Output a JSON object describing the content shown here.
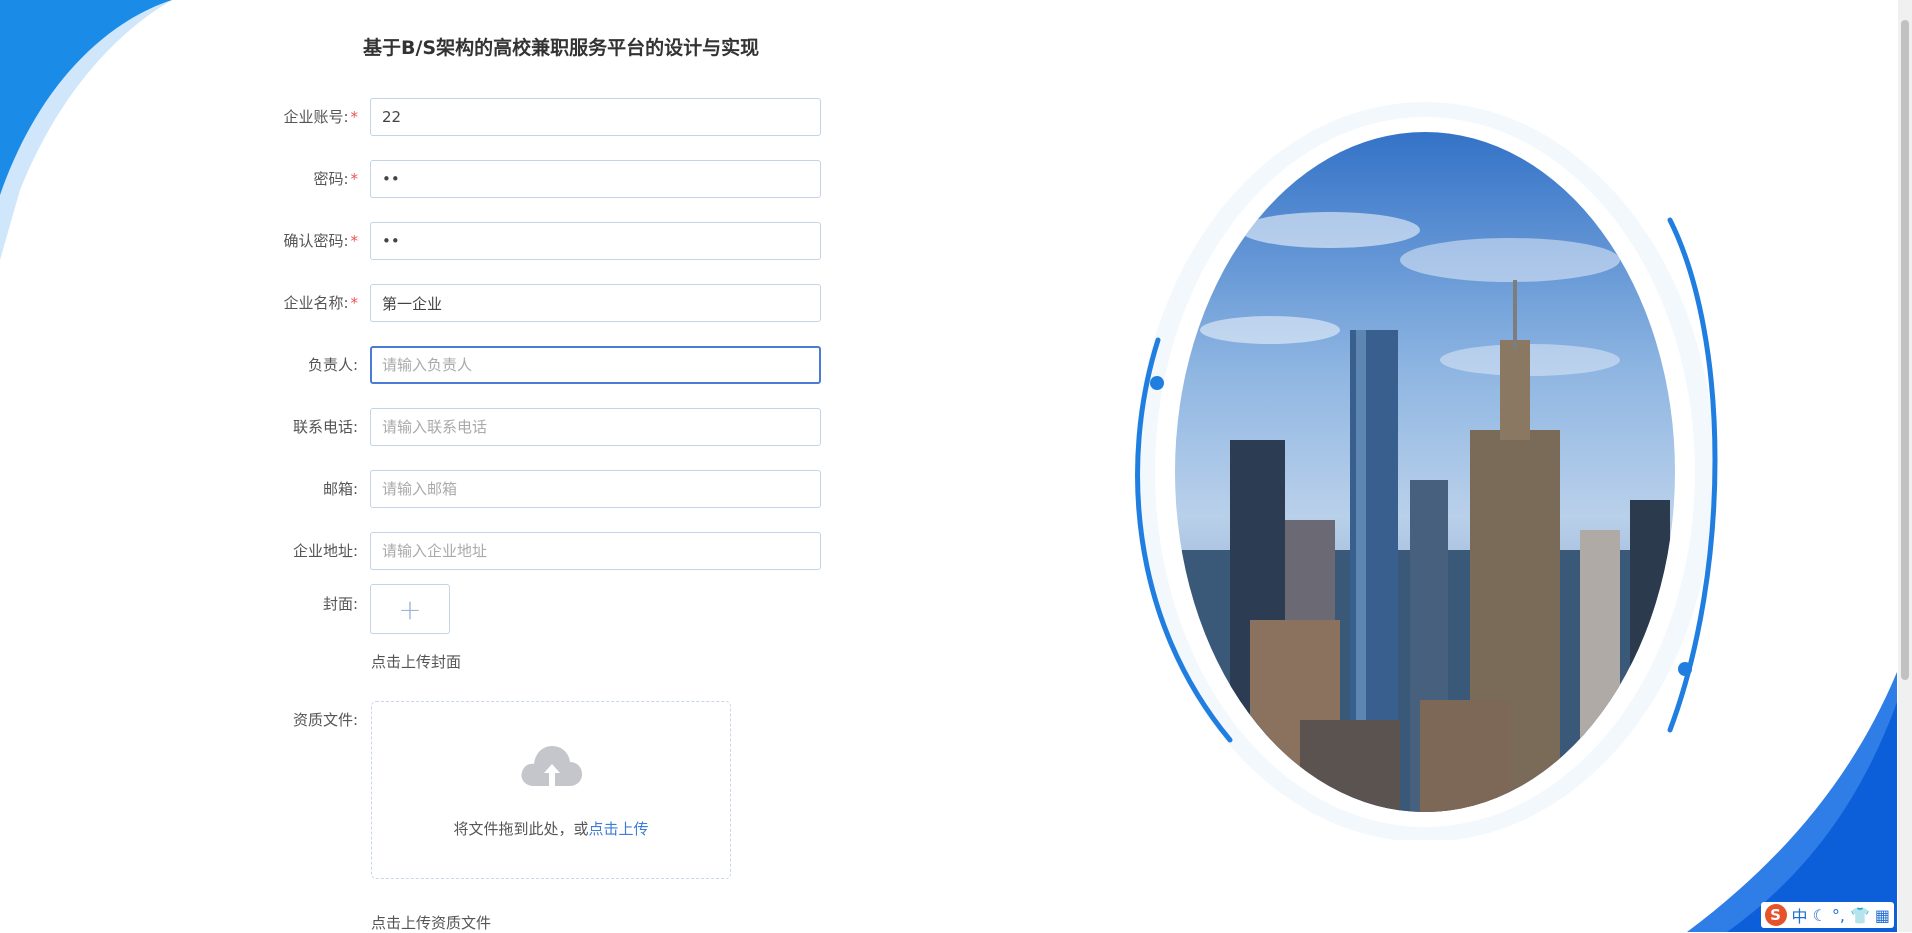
{
  "app": {
    "title": "基于B/S架构的高校兼职服务平台的设计与实现"
  },
  "form": {
    "fields": [
      {
        "label": "企业账号:",
        "required": true,
        "value": "22",
        "placeholder": ""
      },
      {
        "label": "密码:",
        "required": true,
        "value": "••",
        "placeholder": ""
      },
      {
        "label": "确认密码:",
        "required": true,
        "value": "••",
        "placeholder": ""
      },
      {
        "label": "企业名称:",
        "required": true,
        "value": "第一企业",
        "placeholder": ""
      },
      {
        "label": "负责人:",
        "required": false,
        "value": "",
        "placeholder": "请输入负责人"
      },
      {
        "label": "联系电话:",
        "required": false,
        "value": "",
        "placeholder": "请输入联系电话"
      },
      {
        "label": "邮箱:",
        "required": false,
        "value": "",
        "placeholder": "请输入邮箱"
      },
      {
        "label": "企业地址:",
        "required": false,
        "value": "",
        "placeholder": "请输入企业地址"
      }
    ],
    "required_mark": "*",
    "cover": {
      "label": "封面:",
      "plus": "+",
      "hint": "点击上传封面"
    },
    "qualification": {
      "label": "资质文件:",
      "drop_text": "将文件拖到此处，或",
      "drop_link": "点击上传",
      "hint": "点击上传资质文件"
    }
  },
  "ime": {
    "logo": "S",
    "mode": "中"
  },
  "colors": {
    "accent": "#3b7dd8",
    "required": "#e55555",
    "border": "#c3d3e8"
  }
}
